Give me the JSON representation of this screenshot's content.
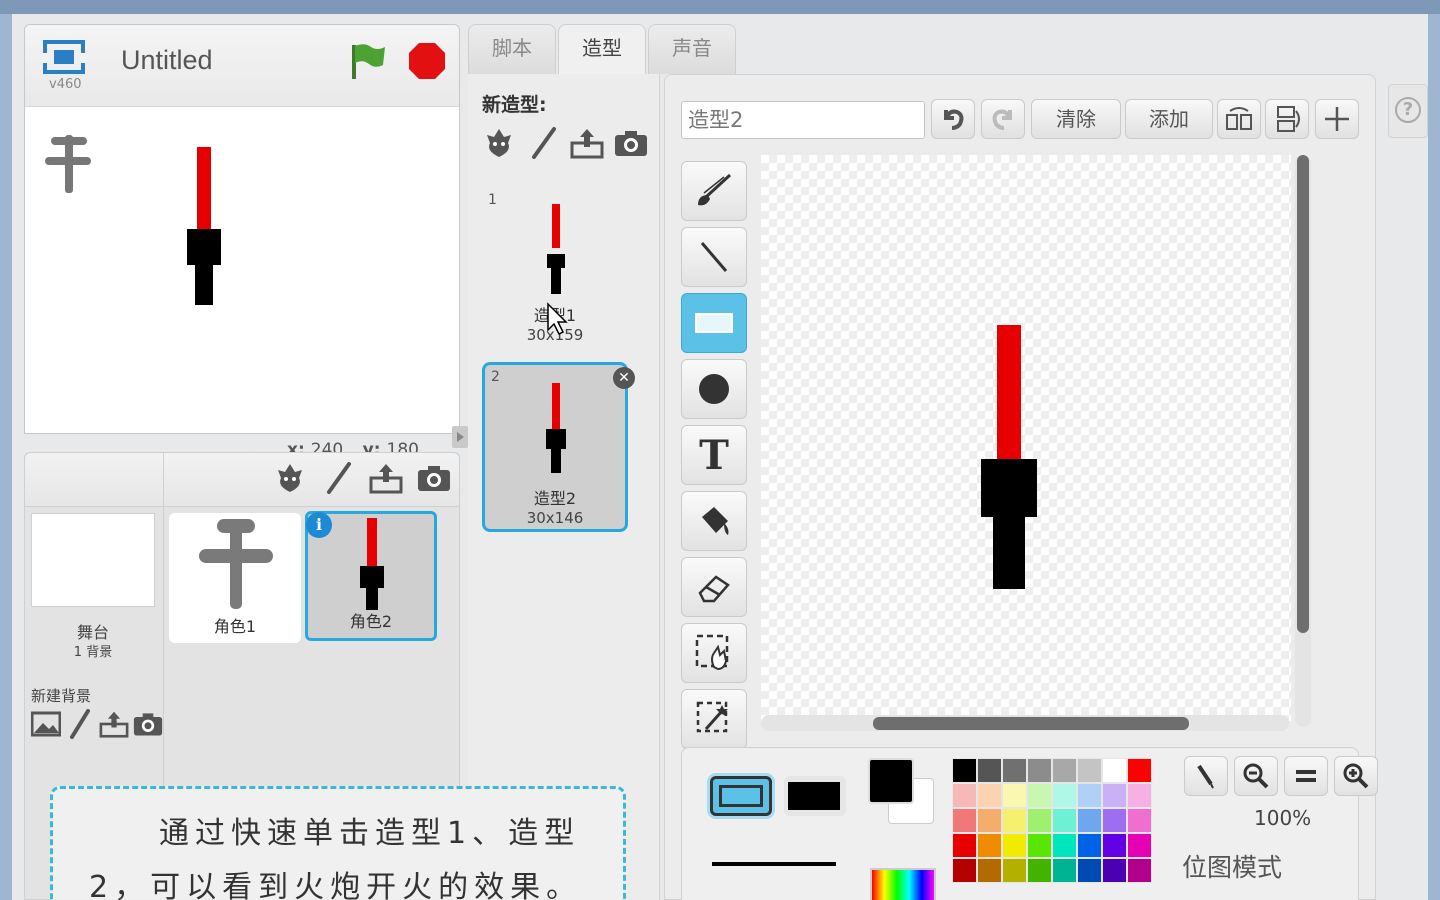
{
  "stage": {
    "version": "v460",
    "title": "Untitled",
    "coords": {
      "x_label": "x:",
      "x_value": "240",
      "y_label": "y:",
      "y_value": "180"
    }
  },
  "sprites": {
    "stage_name": "舞台",
    "stage_backdrops": "1 背景",
    "new_backdrop_label": "新建背景",
    "items": [
      {
        "label": "角色1",
        "selected": false
      },
      {
        "label": "角色2",
        "selected": true
      }
    ]
  },
  "tabs": [
    {
      "label": "脚本",
      "active": false
    },
    {
      "label": "造型",
      "active": true
    },
    {
      "label": "声音",
      "active": false
    }
  ],
  "costumes": {
    "new_label": "新造型:",
    "items": [
      {
        "num": "1",
        "name": "造型1",
        "size": "30x159",
        "selected": false
      },
      {
        "num": "2",
        "name": "造型2",
        "size": "30x146",
        "selected": true
      }
    ]
  },
  "editor": {
    "costume_name": "造型2",
    "clear_label": "清除",
    "add_label": "添加",
    "zoom": "100%",
    "mode_label": "位图模式"
  },
  "tip": {
    "text": "通过快速单击造型1、造型2，可以看到火炮开火的效果。"
  },
  "colors": {
    "accent": "#27a9e0",
    "palette": [
      "#000000",
      "#555555",
      "#707070",
      "#8c8c8c",
      "#a8a8a8",
      "#c4c4c4",
      "#ffffff",
      "#ff0000",
      "#f7b8b8",
      "#fad4b0",
      "#faf7b0",
      "#c9f7b0",
      "#b0f7e7",
      "#b0d1f7",
      "#c9b0f7",
      "#f7b0e4",
      "#f07878",
      "#f5ad6e",
      "#f5f06e",
      "#9ef06e",
      "#6ef0d5",
      "#6ea6f0",
      "#9e6ef0",
      "#f06ed0",
      "#e60000",
      "#f08c00",
      "#f0eb00",
      "#5ae600",
      "#00e6bc",
      "#0062e6",
      "#6200e6",
      "#e600b4",
      "#b30000",
      "#b36b00",
      "#b3b000",
      "#44b300",
      "#00b392",
      "#004bb3",
      "#4b00b3",
      "#b3008c"
    ]
  }
}
